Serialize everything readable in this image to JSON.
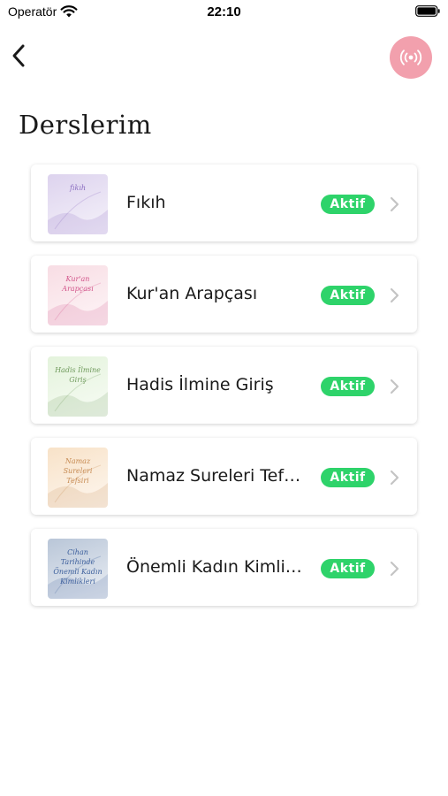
{
  "status_bar": {
    "carrier": "Operatör",
    "time": "22:10"
  },
  "nav": {
    "back_icon": "chevron-left-icon",
    "live_icon": "broadcast-icon",
    "live_color": "#f2a0ad"
  },
  "page": {
    "title": "Derslerim"
  },
  "colors": {
    "badge_green": "#2ed36a",
    "chevron_gray": "#c4c4c4"
  },
  "courses": [
    {
      "title": "Fıkıh",
      "status": "Aktif",
      "thumb_text": "fıkıh",
      "thumb_bg": "#ddd3ee",
      "thumb_ink": "#8a6cc0"
    },
    {
      "title": "Kur'an Arapçası",
      "status": "Aktif",
      "thumb_text": "Kur'an Arapçası",
      "thumb_bg": "#f8dde4",
      "thumb_ink": "#d2548a"
    },
    {
      "title": "Hadis İlmine Giriş",
      "status": "Aktif",
      "thumb_text": "Hadis İlmine Giriş",
      "thumb_bg": "#e4f3dc",
      "thumb_ink": "#6f9a5c"
    },
    {
      "title": "Namaz Sureleri Tefsiri",
      "status": "Aktif",
      "thumb_text": "Namaz Sureleri Tefsiri",
      "thumb_bg": "#f8e2c8",
      "thumb_ink": "#c68a52"
    },
    {
      "title": "Önemli Kadın Kimlikleri",
      "status": "Aktif",
      "thumb_text": "Cihan Tarihinde Önemli Kadın Kimlikleri",
      "thumb_bg": "#b9c6d8",
      "thumb_ink": "#3c5f9c"
    }
  ]
}
